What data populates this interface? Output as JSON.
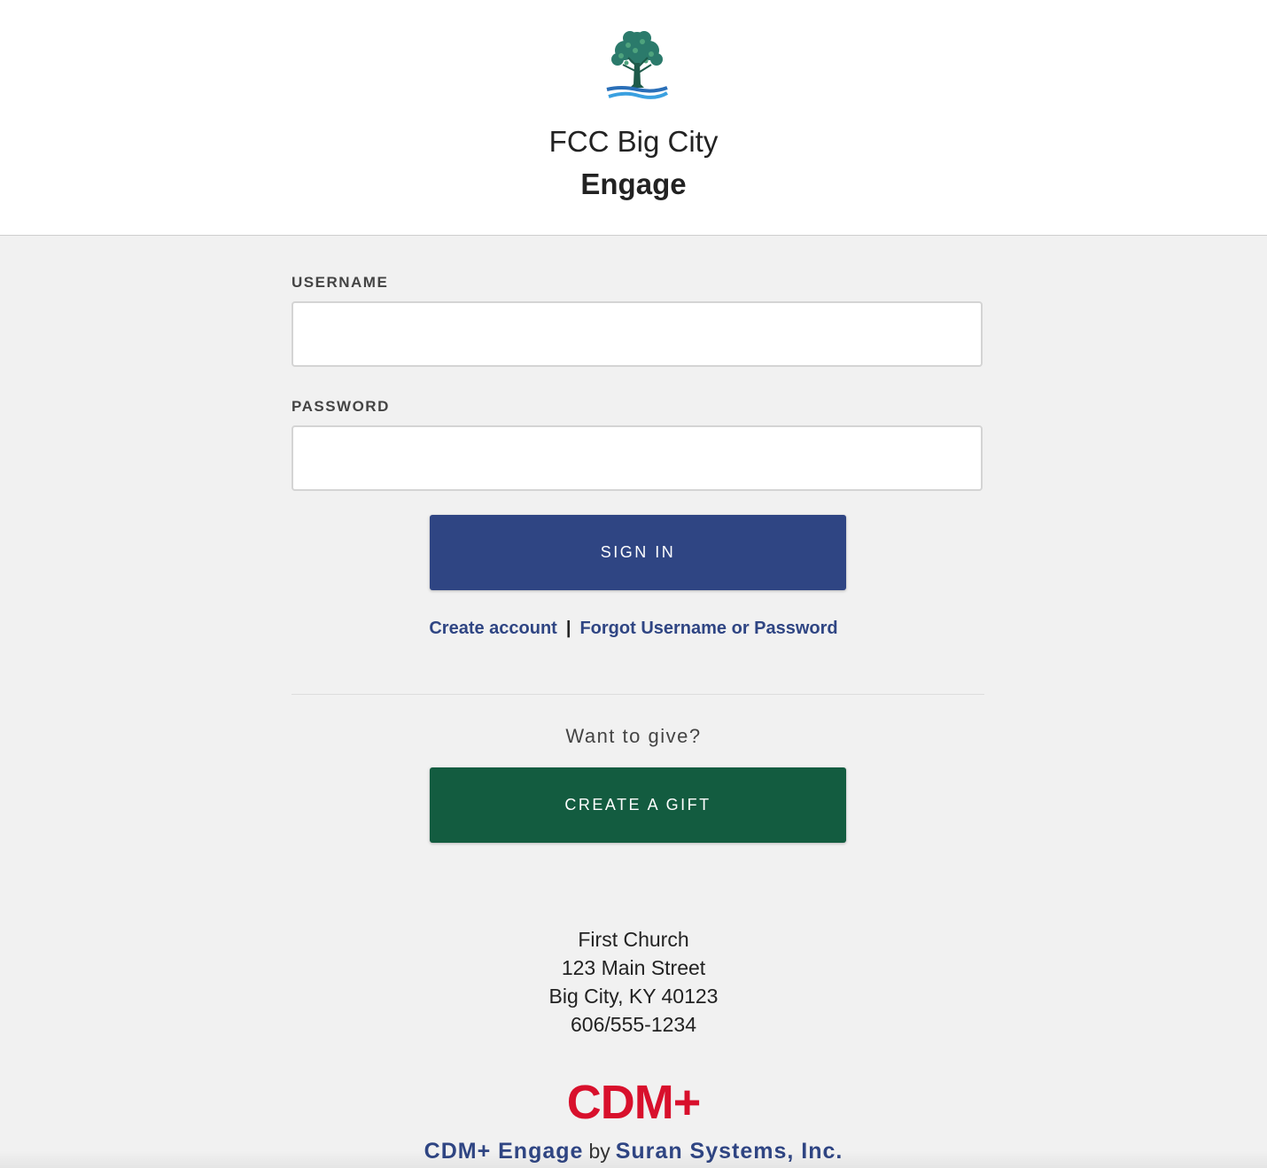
{
  "header": {
    "org_name": "FCC Big City",
    "app_name": "Engage",
    "logo_icon": "tree-logo-icon"
  },
  "login": {
    "username_label": "USERNAME",
    "username_value": "",
    "password_label": "PASSWORD",
    "password_value": "",
    "sign_in_label": "SIGN IN"
  },
  "links": {
    "create_account": "Create account",
    "separator": "|",
    "forgot": "Forgot Username or Password"
  },
  "give": {
    "prompt": "Want to give?",
    "button_label": "CREATE A GIFT"
  },
  "footer": {
    "address_lines": [
      "First Church",
      "123 Main Street",
      "Big City, KY 40123",
      "606/555-1234"
    ],
    "vendor_logo_text": "CDM+",
    "product_name": "CDM+ Engage",
    "by_text": "by",
    "company_name": "Suran Systems, Inc."
  },
  "colors": {
    "primary": "#2f4583",
    "gift": "#135c40",
    "brand_red": "#d8102c",
    "background": "#f1f1f1"
  }
}
